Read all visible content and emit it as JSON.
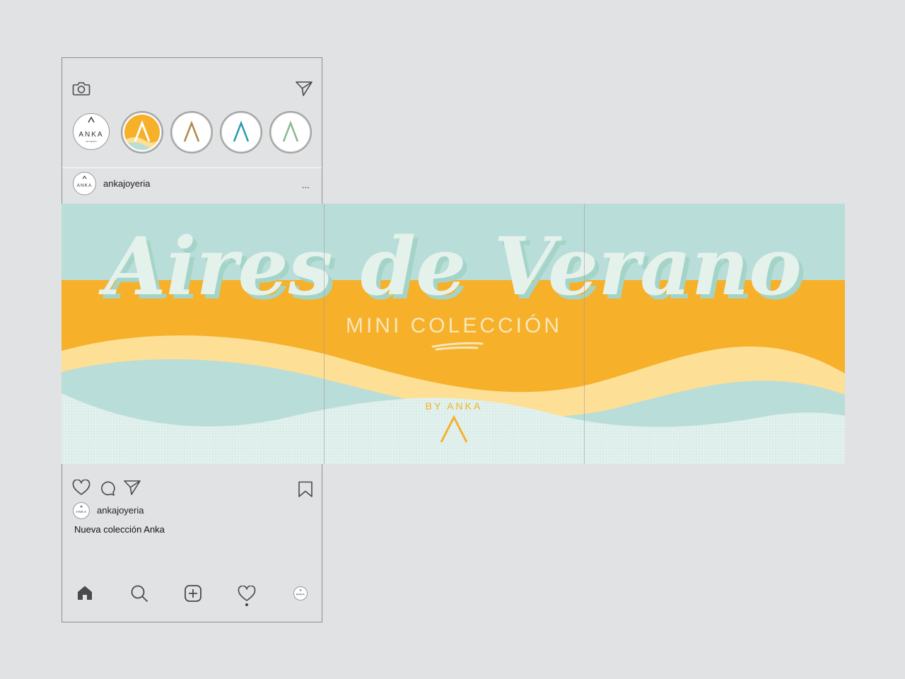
{
  "header": {
    "camera_icon": "camera-icon",
    "direct_icon": "paper-plane-icon"
  },
  "stories": [
    {
      "name": "anka-own-story",
      "logo_text": "ANKA",
      "sub_text": "JOYERÍA"
    },
    {
      "name": "story-yellow",
      "accent": "#f5a623"
    },
    {
      "name": "story-gold",
      "accent": "#b08a4a"
    },
    {
      "name": "story-teal",
      "accent": "#2a9bb5"
    },
    {
      "name": "story-green",
      "accent": "#8ab890"
    }
  ],
  "post": {
    "username": "ankajoyeria",
    "more": "...",
    "banner": {
      "title": "Aires de Verano",
      "subtitle": "MINI COLECCIÓN",
      "byline": "BY ANKA",
      "colors": {
        "mint": "#b9ddd8",
        "yellow": "#f6b02a",
        "cream": "#fddf95",
        "title": "#e5f2ec",
        "shadow": "#a4d4c8",
        "text": "#f6e7b8"
      }
    }
  },
  "caption": {
    "username": "ankajoyeria",
    "text": "Nueva colección Anka"
  },
  "colors": {
    "background": "#e1e2e3",
    "frame": "#8e8e8e",
    "icon": "#4a4a4a"
  }
}
